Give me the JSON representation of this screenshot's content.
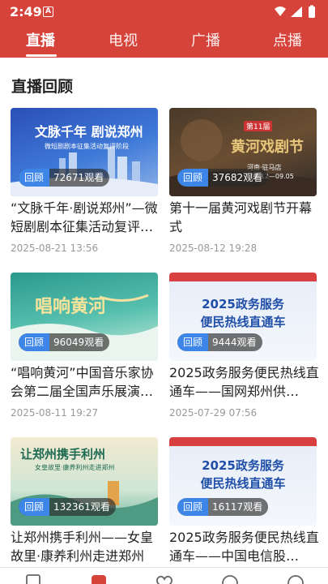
{
  "status": {
    "time": "2:49",
    "notification_icon": "A"
  },
  "tabs": [
    {
      "label": "直播",
      "active": true
    },
    {
      "label": "电视",
      "active": false
    },
    {
      "label": "广播",
      "active": false
    },
    {
      "label": "点播",
      "active": false
    }
  ],
  "section": {
    "title": "直播回顾"
  },
  "cards": [
    {
      "title": "“文脉千年·剧说郑州”—微短剧剧本征集活动复评…",
      "date": "2025-08-21 13:56",
      "tag": "回顾",
      "views": "72671观看",
      "thumb_text": [
        "文脉千年 剧说郑州",
        "微短剧剧本征集活动复评阶段"
      ]
    },
    {
      "title": "第十一届黄河戏剧节开幕式",
      "date": "2025-08-12 19:28",
      "tag": "回顾",
      "views": "37682观看",
      "thumb_text": [
        "第11届",
        "黄河戏剧节",
        "河南·驻马店",
        "08.12—09.05"
      ]
    },
    {
      "title": "“唱响黄河”中国音乐家协会第二届全国声乐展演…",
      "date": "2025-08-11 19:27",
      "tag": "回顾",
      "views": "96049观看",
      "thumb_text": [
        "唱响黄河"
      ]
    },
    {
      "title": "2025政务服务便民热线直通车——国网郑州供…",
      "date": "2025-07-29 07:56",
      "tag": "回顾",
      "views": "9444观看",
      "thumb_text": [
        "2025政务服务",
        "便民热线直通车"
      ]
    },
    {
      "title": "让郑州携手利州——女皇故里·康养利州走进郑州",
      "date": "",
      "tag": "回顾",
      "views": "132361观看",
      "thumb_text": [
        "让郑州携手利州",
        "女皇故里·康养利州走进郑州"
      ]
    },
    {
      "title": "2025政务服务便民热线直通车——中国电信股…",
      "date": "",
      "tag": "回顾",
      "views": "16117观看",
      "thumb_text": [
        "2025政务服务",
        "便民热线直通车"
      ]
    }
  ],
  "colors": {
    "header": "#d5433a",
    "badge_tag": "#3d86e8"
  }
}
